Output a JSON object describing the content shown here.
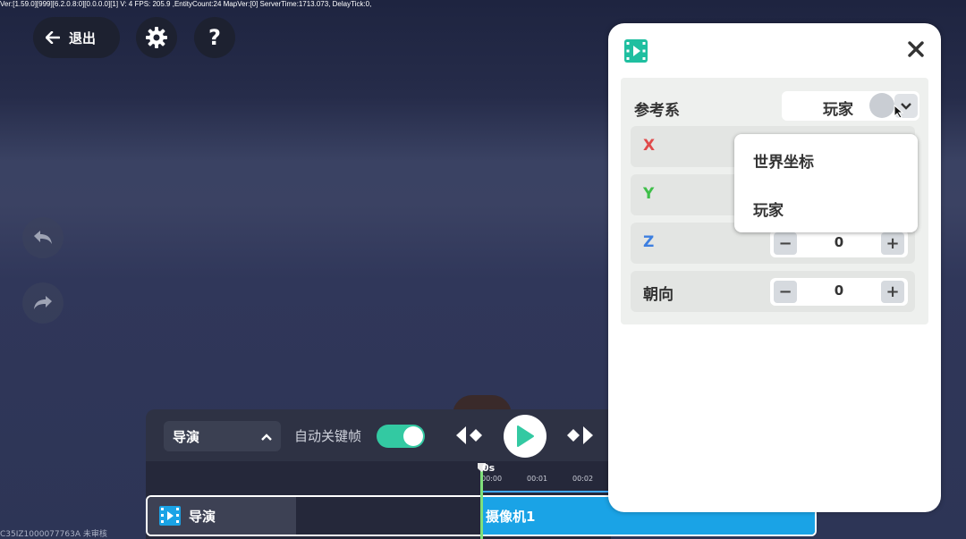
{
  "debug_text": "Ver:[1.59.0][999][6.2.0.8:0][0.0.0.0][1] V: 4 FPS: 205.9   ,EntityCount:24   MapVer:[0]   ServerTime:1713.073,    DelayTick:0,",
  "top_bar": {
    "exit_label": "退出",
    "help_label": "?"
  },
  "watermark": "C35IZ1000077763A 未审核",
  "toolbar": {
    "mode_value": "导演",
    "auto_keyframe_label": "自动关键帧",
    "auto_keyframe_on": true
  },
  "timeline": {
    "current_time": "0s",
    "ticks": [
      "00:00",
      "00:01",
      "00:02"
    ],
    "track_name": "导演",
    "clip_name": "摄像机1"
  },
  "panel": {
    "reference_label": "参考系",
    "reference_value": "玩家",
    "rows": [
      {
        "label": "X",
        "value": "",
        "color": "#e04b4b"
      },
      {
        "label": "Y",
        "value": "",
        "color": "#3fbf4a"
      },
      {
        "label": "Z",
        "value": "0",
        "color": "#3d7fe0"
      },
      {
        "label": "朝向",
        "value": "0",
        "color": "#333333"
      }
    ],
    "minus_label": "−",
    "plus_label": "+"
  },
  "dropdown": {
    "options": [
      "世界坐标",
      "玩家"
    ]
  },
  "colors": {
    "accent_green": "#33c9a2",
    "clip_blue": "#1aa3e6",
    "panel_icon": "#1fbfa0"
  }
}
